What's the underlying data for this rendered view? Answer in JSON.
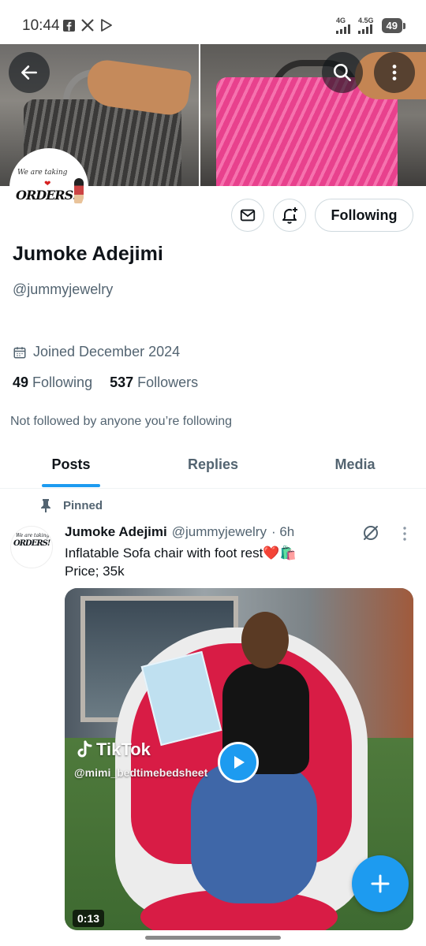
{
  "status_bar": {
    "time": "10:44",
    "net1": "4G",
    "net2": "4.5G",
    "battery": "49"
  },
  "profile": {
    "name": "Jumoke Adejimi",
    "handle": "@jummyjewelry",
    "joined": "Joined December 2024",
    "following_count": "49",
    "following_label": "Following",
    "followers_count": "537",
    "followers_label": "Followers",
    "not_followed": "Not followed by anyone you’re following",
    "follow_button": "Following",
    "avatar_text_small": "We are taking",
    "avatar_text_big": "ORDERS!"
  },
  "tabs": [
    {
      "label": "Posts",
      "active": true
    },
    {
      "label": "Replies",
      "active": false
    },
    {
      "label": "Media",
      "active": false
    }
  ],
  "post": {
    "pinned_label": "Pinned",
    "author_name": "Jumoke Adejimi",
    "author_handle": "@jummyjewelry",
    "time": "· 6h",
    "line1": "Inflatable Sofa chair with foot rest❤️🛍️",
    "line2": "Price; 35k",
    "video": {
      "watermark": "TikTok",
      "watermark_user": "@mimi_bedtimebedsheet",
      "duration": "0:13"
    }
  },
  "colors": {
    "accent": "#1d9bf0",
    "text_primary": "#0f1419",
    "text_secondary": "#536471"
  }
}
